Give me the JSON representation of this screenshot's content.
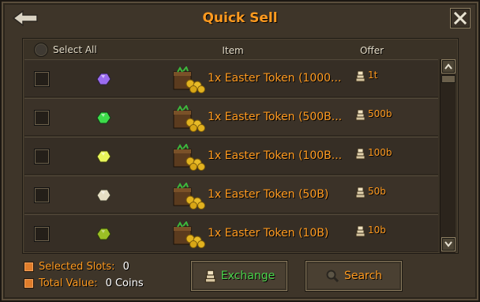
{
  "window": {
    "title": "Quick Sell"
  },
  "header": {
    "select_all_label": "Select All",
    "item_column": "Item",
    "offer_column": "Offer"
  },
  "rows": [
    {
      "name": "1x Easter Token (1000...",
      "offer": "1t",
      "gem_color": "#9b6cf0",
      "checked": false
    },
    {
      "name": "1x Easter Token (500B...",
      "offer": "500b",
      "gem_color": "#3ddc4a",
      "checked": false
    },
    {
      "name": "1x Easter Token (100B...",
      "offer": "100b",
      "gem_color": "#e8f55a",
      "checked": false
    },
    {
      "name": "1x Easter Token (50B)",
      "offer": "50b",
      "gem_color": "#e6dfc4",
      "checked": false
    },
    {
      "name": "1x Easter Token (10B)",
      "offer": "10b",
      "gem_color": "#9bbf25",
      "checked": false
    }
  ],
  "footer": {
    "selected_slots_label": "Selected Slots:",
    "selected_slots_value": "0",
    "total_value_label": "Total Value:",
    "total_value_value": "0 Coins"
  },
  "buttons": {
    "exchange_label": "Exchange",
    "search_label": "Search"
  },
  "colors": {
    "accent": "#ff9a1f",
    "exchange_green": "#4bd24b",
    "info_box": "#e07d2b"
  },
  "icons": {
    "back": "back-arrow-icon",
    "close": "close-icon",
    "token": "token-chest-icon",
    "offer": "coin-stack-icon",
    "search": "magnifier-icon"
  }
}
